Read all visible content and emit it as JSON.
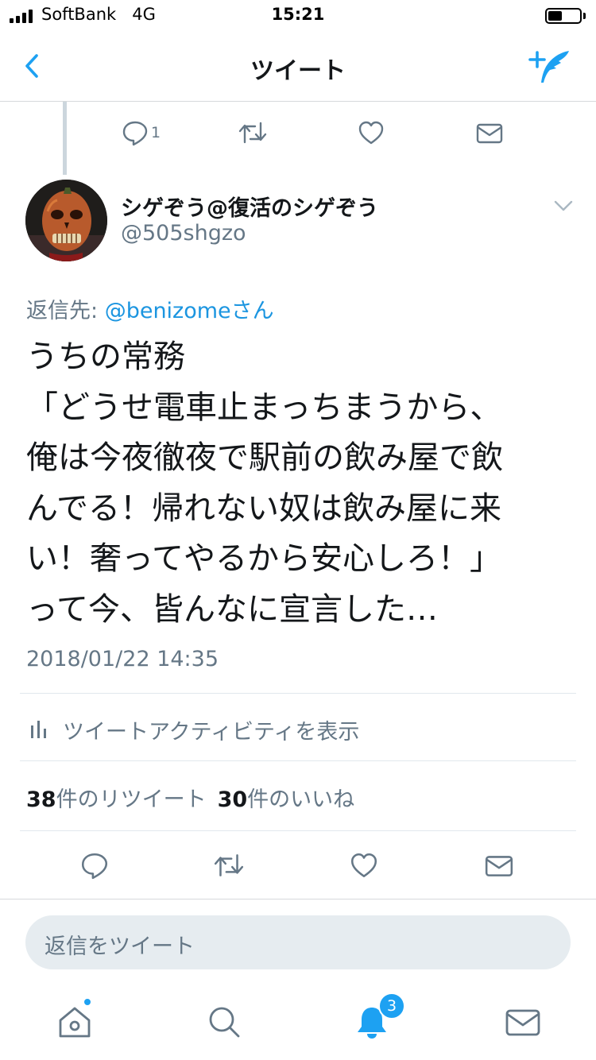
{
  "status_bar": {
    "carrier": "SoftBank",
    "network": "4G",
    "time": "15:21"
  },
  "nav": {
    "title": "ツイート"
  },
  "previous_tweet": {
    "reply_count": "1"
  },
  "author": {
    "display_name": "シゲぞう@復活のシゲぞう",
    "handle": "@505shgzo"
  },
  "reply_to": {
    "prefix": "返信先: ",
    "mention": "@benizomeさん"
  },
  "tweet": {
    "lines": [
      "うちの常務",
      "「どうせ電車止まっちまうから、",
      "俺は今夜徹夜で駅前の飲み屋で飲",
      "んでる！帰れない奴は飲み屋に来",
      "い！奢ってやるから安心しろ！」",
      "って今、皆んなに宣言した…"
    ],
    "timestamp": "2018/01/22 14:35"
  },
  "activity": {
    "label": "ツイートアクティビティを表示"
  },
  "stats": {
    "retweet_count": "38",
    "retweet_label": "件のリツイート",
    "like_count": "30",
    "like_label": "件のいいね"
  },
  "reply_box": {
    "placeholder": "返信をツイート"
  },
  "tab_bar": {
    "notification_badge": "3"
  },
  "colors": {
    "accent": "#1da1f2",
    "text": "#14171a",
    "secondary": "#657786",
    "divider": "#e1e8ed",
    "input_bg": "#e6ecf0"
  }
}
